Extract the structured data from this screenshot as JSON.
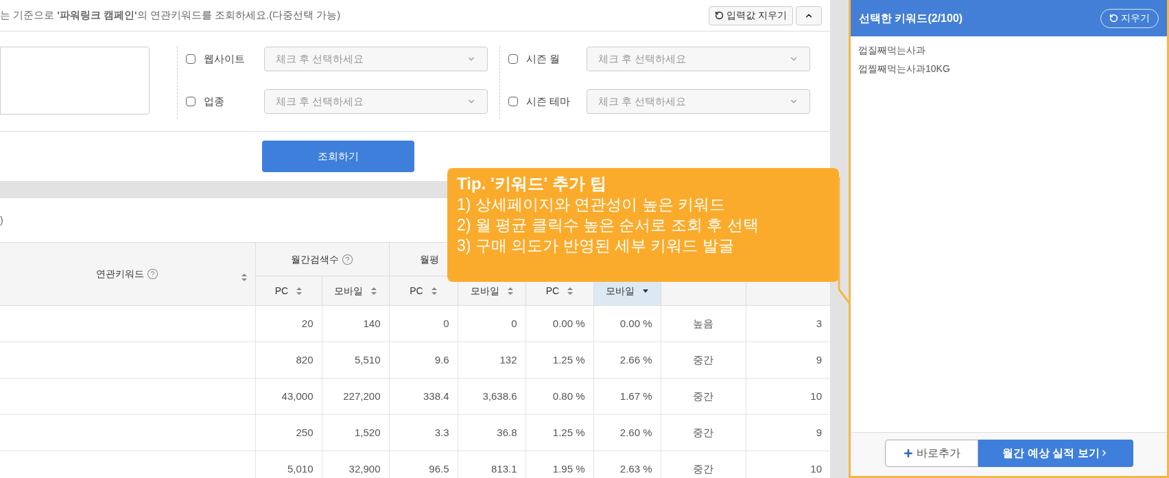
{
  "header": {
    "instruction": "는 기준으로 **'파워링크 캠페인'**의 연관키워드를 조회하세요.(다중선택 가능)",
    "reset_button": "입력값 지우기"
  },
  "filter_groups": [
    [
      {
        "label": "웹사이트",
        "checked": false,
        "placeholder": "체크 후 선택하세요"
      },
      {
        "label": "업종",
        "checked": false,
        "placeholder": "체크 후 선택하세요"
      }
    ],
    [
      {
        "label": "시즌 월",
        "checked": false,
        "placeholder": "체크 후 선택하세요"
      },
      {
        "label": "시즌 테마",
        "checked": false,
        "placeholder": "체크 후 선택하세요"
      }
    ]
  ],
  "search_button": "조회하기",
  "results": {
    "summary_fragment": ")"
  },
  "table": {
    "keyword_column": "연관키워드",
    "groups": [
      "월간검색수",
      "월평"
    ],
    "subcolumns": [
      {
        "label": "PC",
        "sorted_desc": false
      },
      {
        "label": "모바일",
        "sorted_desc": false
      },
      {
        "label": "PC",
        "sorted_desc": false
      },
      {
        "label": "모바일",
        "sorted_desc": false
      },
      {
        "label": "PC",
        "sorted_desc": false
      },
      {
        "label": "모바일",
        "sorted_desc": true
      }
    ],
    "rows": [
      [
        "20",
        "140",
        "0",
        "0",
        "0.00 %",
        "0.00 %",
        "높음",
        "3"
      ],
      [
        "820",
        "5,510",
        "9.6",
        "132",
        "1.25 %",
        "2.66 %",
        "중간",
        "9"
      ],
      [
        "43,000",
        "227,200",
        "338.4",
        "3,638.6",
        "0.80 %",
        "1.67 %",
        "중간",
        "10"
      ],
      [
        "250",
        "1,520",
        "3.3",
        "36.8",
        "1.25 %",
        "2.60 %",
        "중간",
        "9"
      ],
      [
        "5,010",
        "32,900",
        "96.5",
        "813.1",
        "1.95 %",
        "2.63 %",
        "중간",
        "10"
      ]
    ]
  },
  "tip": {
    "title": "Tip. '키워드' 추가 팁",
    "lines": [
      "1)  상세페이지와 연관성이 높은 키워드",
      "2) 월 평균 클릭수 높은 순서로 조회 후 선택",
      "3) 구매 의도가 반영된 세부 키워드 발굴"
    ]
  },
  "selected_panel": {
    "title": "선택한 키워드(2/100)",
    "clear_button": "지우기",
    "keywords": [
      "껍질째먹는사과",
      "껍찔째먹는사과10KG"
    ],
    "add_button": "바로추가",
    "forecast_button": "월간 예상 실적 보기"
  }
}
